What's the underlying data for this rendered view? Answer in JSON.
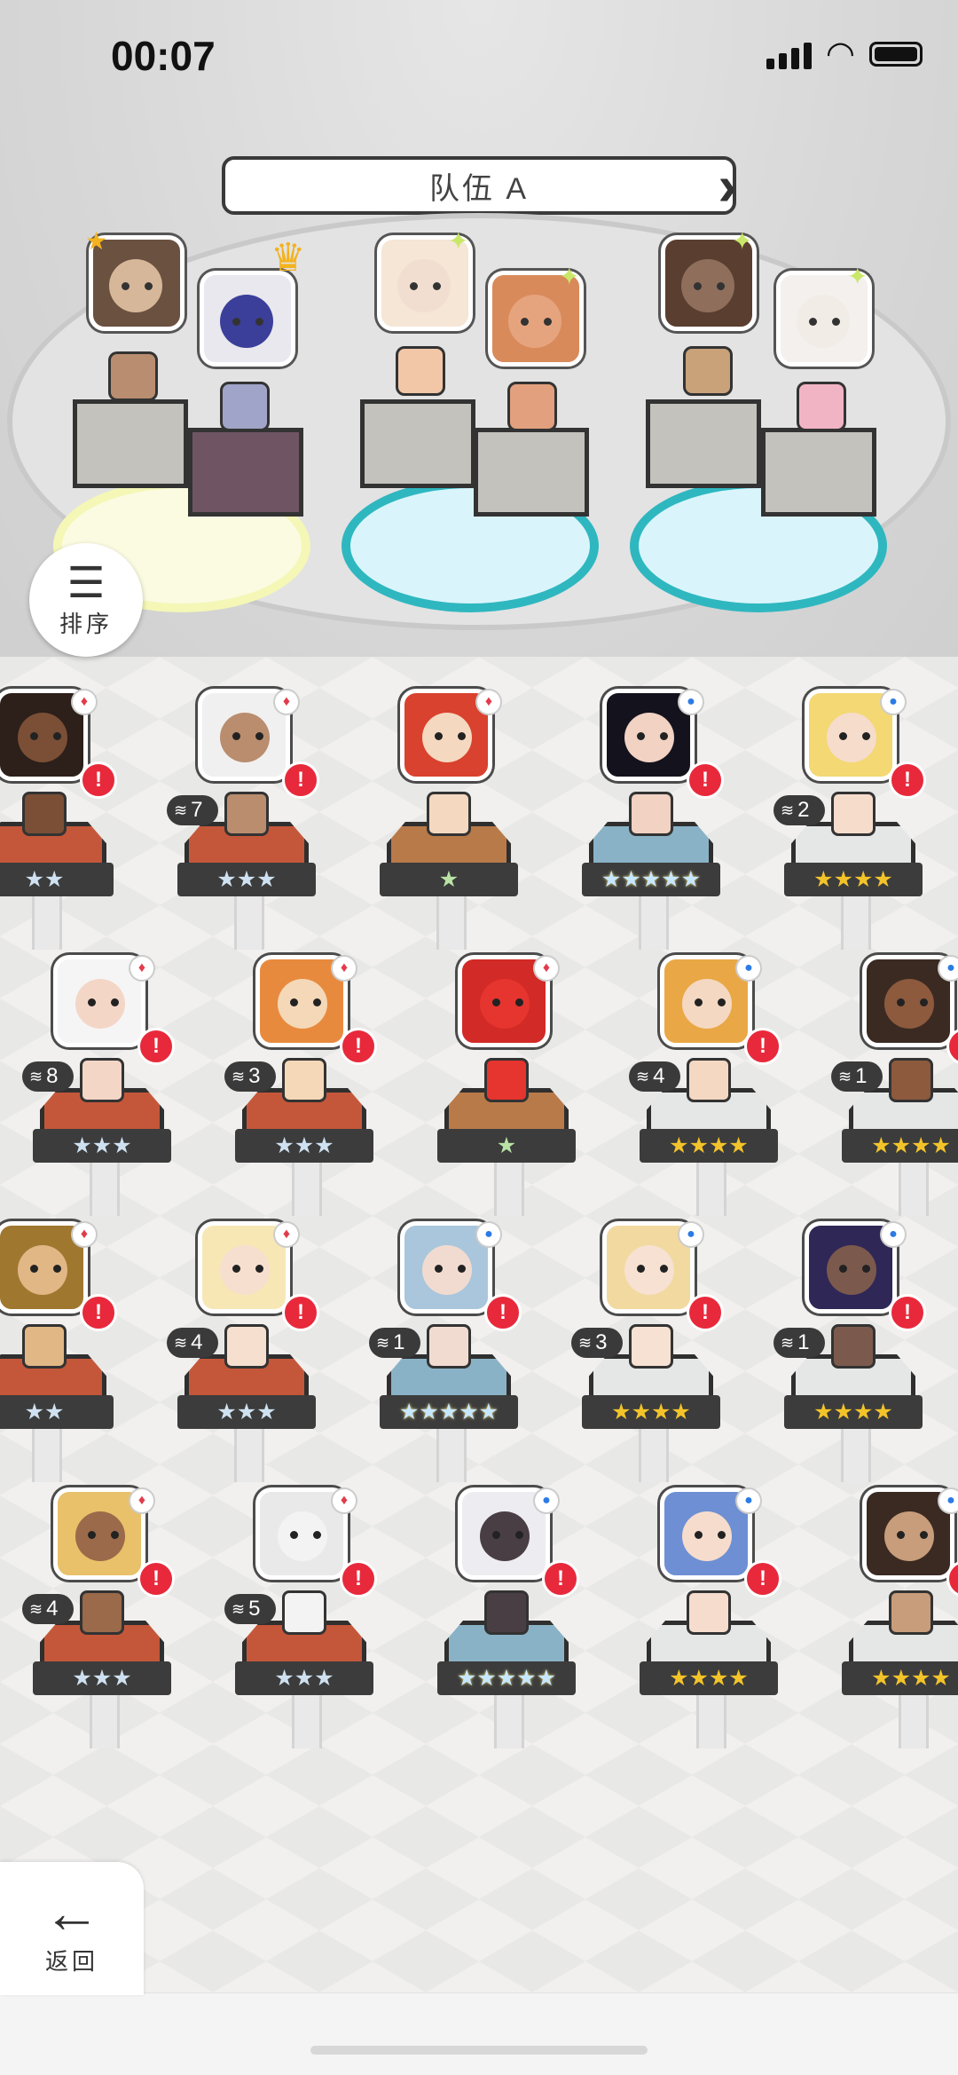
{
  "status_bar": {
    "time": "00:07"
  },
  "team": {
    "name": "队伍 A",
    "prev_icon": "chevron-left-icon",
    "next_icon": "chevron-right-icon"
  },
  "sort_button": {
    "label": "排序",
    "icon": "sort-icon"
  },
  "back_button": {
    "label": "返回",
    "icon": "arrow-left-icon"
  },
  "team_slots": [
    {
      "portrait_color": "#d7b79a",
      "hair": "#6b5140",
      "pad": "yellow",
      "extra": "star-icon"
    },
    {
      "portrait_color": "#3b3f9a",
      "hair": "#e8e8ee",
      "pad": "yellow",
      "extra": "crown-icon"
    },
    {
      "portrait_color": "#f2ded0",
      "hair": "#f5e6d6",
      "pad": "cyan",
      "extra": "sparkle-icon"
    },
    {
      "portrait_color": "#e6a47e",
      "hair": "#d98a5a",
      "pad": "cyan",
      "extra": "sparkle-icon"
    },
    {
      "portrait_color": "#8f6e5c",
      "hair": "#5a3f30",
      "pad": "cyan",
      "extra": "sparkle-icon"
    },
    {
      "portrait_color": "#f2ece6",
      "hair": "#f4f0ee",
      "pad": "cyan",
      "extra": "sparkle-icon"
    }
  ],
  "colors": {
    "alert_red": "#e8293b",
    "badge_blue": "#2c7be5",
    "star_gold": "#f3c42a"
  },
  "units": [
    {
      "row": 0,
      "col": 0,
      "stars": "★★",
      "star_style": "silver",
      "hex": "red",
      "badge": "red",
      "face": "#7a4f36",
      "hair": "#2d1f19",
      "alert": "!",
      "dupe": ""
    },
    {
      "row": 0,
      "col": 1,
      "stars": "★★★",
      "star_style": "silver",
      "hex": "red",
      "badge": "red",
      "face": "#b98d6e",
      "hair": "#f0f0f0",
      "alert": "!",
      "dupe": "7"
    },
    {
      "row": 0,
      "col": 2,
      "stars": "★",
      "star_style": "green",
      "hex": "brown",
      "badge": "red",
      "face": "#f5d8c0",
      "hair": "#d9422e",
      "alert": "",
      "dupe": ""
    },
    {
      "row": 0,
      "col": 3,
      "stars": "★★★★★",
      "star_style": "rainbow",
      "hex": "blue",
      "badge": "blue",
      "face": "#f1d2c3",
      "hair": "#14131d",
      "alert": "!",
      "dupe": ""
    },
    {
      "row": 0,
      "col": 4,
      "stars": "★★★★",
      "star_style": "gold",
      "hex": "white",
      "badge": "blue",
      "face": "#f6dccb",
      "hair": "#f3d873",
      "alert": "!",
      "dupe": "2"
    },
    {
      "row": 1,
      "col": 0,
      "stars": "★★★",
      "star_style": "silver",
      "hex": "red",
      "badge": "red",
      "face": "#f4d6c7",
      "hair": "#f5f5f5",
      "alert": "!",
      "dupe": "8"
    },
    {
      "row": 1,
      "col": 1,
      "stars": "★★★",
      "star_style": "silver",
      "hex": "red",
      "badge": "red",
      "face": "#f4d8b8",
      "hair": "#e88a3e",
      "alert": "!",
      "dupe": "3"
    },
    {
      "row": 1,
      "col": 2,
      "stars": "★",
      "star_style": "green",
      "hex": "brown",
      "badge": "red",
      "face": "#e6342e",
      "hair": "#d22a26",
      "alert": "",
      "dupe": ""
    },
    {
      "row": 1,
      "col": 3,
      "stars": "★★★★",
      "star_style": "gold",
      "hex": "white",
      "badge": "blue",
      "face": "#f4d8c2",
      "hair": "#e9a845",
      "alert": "!",
      "dupe": "4"
    },
    {
      "row": 1,
      "col": 4,
      "stars": "★★★★",
      "star_style": "gold",
      "hex": "white",
      "badge": "blue",
      "face": "#8d5a3e",
      "hair": "#3b2a22",
      "alert": "!",
      "dupe": "1"
    },
    {
      "row": 2,
      "col": 0,
      "stars": "★★",
      "star_style": "silver",
      "hex": "red",
      "badge": "red",
      "face": "#e1b786",
      "hair": "#a0772f",
      "alert": "!",
      "dupe": ""
    },
    {
      "row": 2,
      "col": 1,
      "stars": "★★★",
      "star_style": "silver",
      "hex": "red",
      "badge": "red",
      "face": "#f6dfcf",
      "hair": "#f6e7b5",
      "alert": "!",
      "dupe": "4"
    },
    {
      "row": 2,
      "col": 2,
      "stars": "★★★★★",
      "star_style": "rainbow",
      "hex": "blue",
      "badge": "blue",
      "face": "#f1dbd0",
      "hair": "#a9c6dc",
      "alert": "!",
      "dupe": "1"
    },
    {
      "row": 2,
      "col": 3,
      "stars": "★★★★",
      "star_style": "gold",
      "hex": "white",
      "badge": "blue",
      "face": "#f6e1d2",
      "hair": "#f2d99f",
      "alert": "!",
      "dupe": "3"
    },
    {
      "row": 2,
      "col": 4,
      "stars": "★★★★",
      "star_style": "gold",
      "hex": "white",
      "badge": "blue",
      "face": "#7b5a4d",
      "hair": "#2f2756",
      "alert": "!",
      "dupe": "1"
    },
    {
      "row": 3,
      "col": 0,
      "stars": "★★★",
      "star_style": "silver",
      "hex": "red",
      "badge": "red",
      "face": "#9a6a4a",
      "hair": "#e8c16a",
      "alert": "!",
      "dupe": "4"
    },
    {
      "row": 3,
      "col": 1,
      "stars": "★★★",
      "star_style": "silver",
      "hex": "red",
      "badge": "red",
      "face": "#f3f3f3",
      "hair": "#e9e9e9",
      "alert": "!",
      "dupe": "5"
    },
    {
      "row": 3,
      "col": 2,
      "stars": "★★★★★",
      "star_style": "rainbow",
      "hex": "blue",
      "badge": "blue",
      "face": "#4a3e45",
      "hair": "#ededf1",
      "alert": "!",
      "dupe": ""
    },
    {
      "row": 3,
      "col": 3,
      "stars": "★★★★",
      "star_style": "gold",
      "hex": "white",
      "badge": "blue",
      "face": "#f5dccc",
      "hair": "#6e8fd3",
      "alert": "!",
      "dupe": ""
    },
    {
      "row": 3,
      "col": 4,
      "stars": "★★★★",
      "star_style": "gold",
      "hex": "white",
      "badge": "blue",
      "face": "#c89d7b",
      "hair": "#3a2a22",
      "alert": "!",
      "dupe": ""
    }
  ]
}
